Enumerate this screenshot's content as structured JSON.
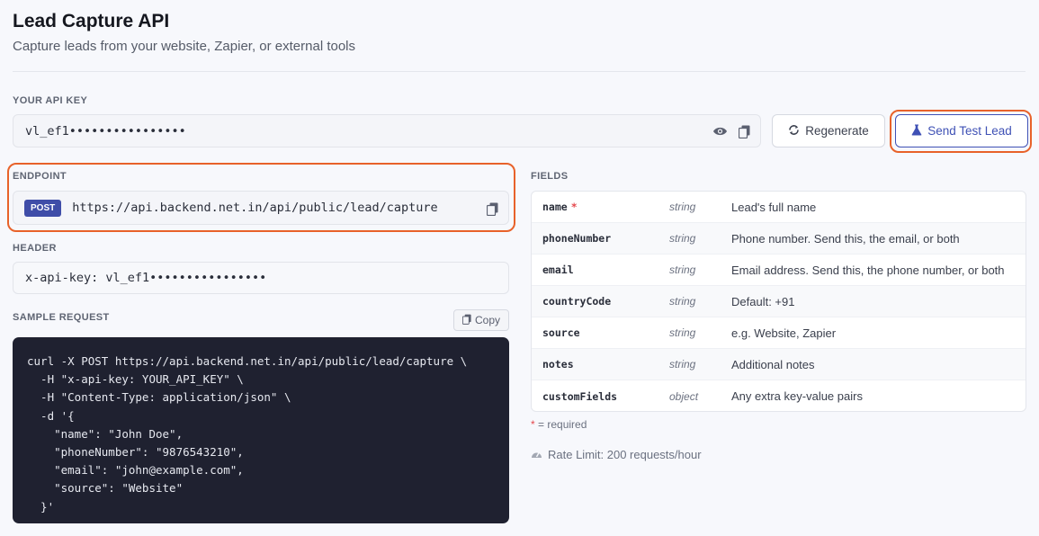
{
  "header": {
    "title": "Lead Capture API",
    "subtitle": "Capture leads from your website, Zapier, or external tools"
  },
  "api_key": {
    "label": "YOUR API KEY",
    "value": "vl_ef1••••••••••••••••",
    "show_icon": "eye-icon",
    "copy_icon": "copy-icon"
  },
  "actions": {
    "regenerate_label": "Regenerate",
    "send_test_label": "Send Test Lead"
  },
  "endpoint": {
    "label": "ENDPOINT",
    "method": "POST",
    "url": "https://api.backend.net.in/api/public/lead/capture"
  },
  "header_section": {
    "label": "HEADER",
    "value": "x-api-key: vl_ef1••••••••••••••••"
  },
  "sample": {
    "label": "SAMPLE REQUEST",
    "copy_label": "Copy",
    "code": "curl -X POST https://api.backend.net.in/api/public/lead/capture \\\n  -H \"x-api-key: YOUR_API_KEY\" \\\n  -H \"Content-Type: application/json\" \\\n  -d '{\n    \"name\": \"John Doe\",\n    \"phoneNumber\": \"9876543210\",\n    \"email\": \"john@example.com\",\n    \"source\": \"Website\"\n  }'"
  },
  "fields": {
    "label": "FIELDS",
    "rows": [
      {
        "name": "name",
        "required": "*",
        "type": "string",
        "desc": "Lead's full name"
      },
      {
        "name": "phoneNumber",
        "required": "",
        "type": "string",
        "desc": "Phone number. Send this, the email, or both"
      },
      {
        "name": "email",
        "required": "",
        "type": "string",
        "desc": "Email address. Send this, the phone number, or both"
      },
      {
        "name": "countryCode",
        "required": "",
        "type": "string",
        "desc": "Default: +91"
      },
      {
        "name": "source",
        "required": "",
        "type": "string",
        "desc": "e.g. Website, Zapier"
      },
      {
        "name": "notes",
        "required": "",
        "type": "string",
        "desc": "Additional notes"
      },
      {
        "name": "customFields",
        "required": "",
        "type": "object",
        "desc": "Any extra key-value pairs"
      }
    ],
    "required_star": "*",
    "required_note": " = required",
    "rate_limit": "Rate Limit: 200 requests/hour"
  },
  "colors": {
    "accent": "#3f51b5",
    "highlight": "#e8622a",
    "code_bg": "#1f2130",
    "required": "#e5484d"
  }
}
